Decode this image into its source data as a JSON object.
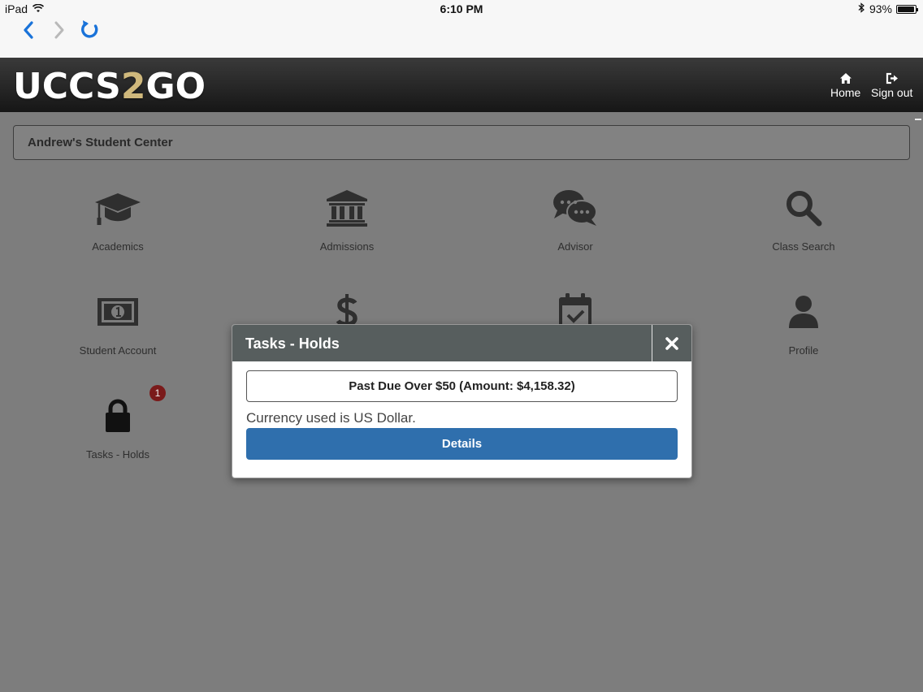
{
  "status_bar": {
    "device": "iPad",
    "time": "6:10 PM",
    "battery": "93%",
    "battery_level": 0.93
  },
  "browser": {
    "back_icon": "chevron-left-icon",
    "forward_icon": "chevron-right-icon",
    "reload_icon": "reload-icon"
  },
  "header": {
    "logo_part1": "UCCS",
    "logo_part2": "2",
    "logo_part3": "GO",
    "home_label": "Home",
    "signout_label": "Sign out"
  },
  "center": {
    "title": "Andrew's Student Center"
  },
  "tiles": [
    {
      "label": "Academics",
      "icon": "graduation-cap-icon"
    },
    {
      "label": "Admissions",
      "icon": "institution-icon"
    },
    {
      "label": "Advisor",
      "icon": "chat-bubbles-icon"
    },
    {
      "label": "Class Search",
      "icon": "search-icon"
    },
    {
      "label": "Student Account",
      "icon": "money-bill-icon"
    },
    {
      "label": "",
      "icon": "dollar-icon"
    },
    {
      "label": "",
      "icon": "calendar-check-icon"
    },
    {
      "label": "Profile",
      "icon": "user-icon"
    },
    {
      "label": "Tasks - Holds",
      "icon": "lock-icon",
      "badge": "1"
    }
  ],
  "modal": {
    "title": "Tasks - Holds",
    "hold": "Past Due Over $50 (Amount: $4,158.32)",
    "currency_note": "Currency used is US Dollar.",
    "details_label": "Details"
  },
  "colors": {
    "header_bg": "#1f1f1f",
    "logo_accent": "#cfb87c",
    "primary_button": "#2f6fad",
    "badge": "#7a1a1a",
    "overlay_bg": "#7d7d7d"
  }
}
